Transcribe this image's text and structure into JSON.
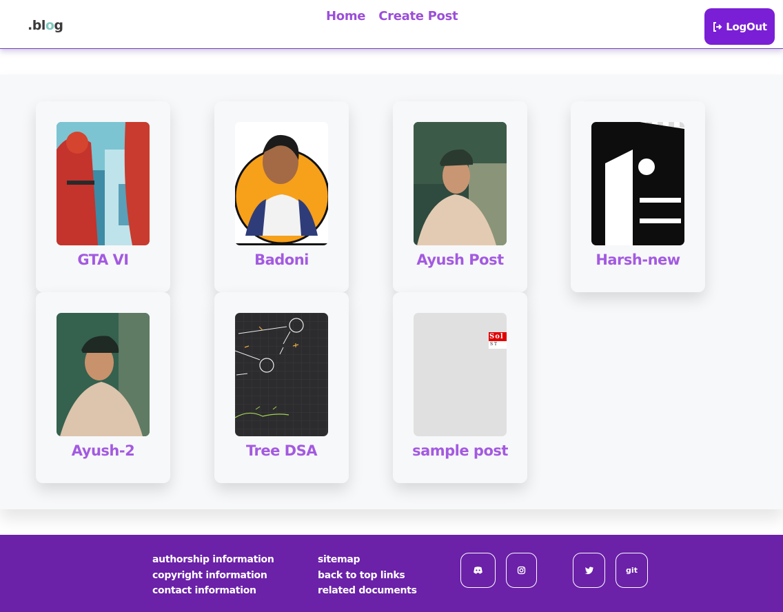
{
  "header": {
    "logo_prefix": ".bl",
    "logo_o": "o",
    "logo_suffix": "g",
    "nav": [
      {
        "label": "Home"
      },
      {
        "label": "Create Post"
      }
    ],
    "logout_label": "LogOut"
  },
  "posts": [
    {
      "title": "GTA VI",
      "image": "gta-vi-art"
    },
    {
      "title": "Badoni",
      "image": "portrait-orange-circle"
    },
    {
      "title": "Ayush Post",
      "image": "selfie-photo"
    },
    {
      "title": "Harsh-new",
      "image": "company-logo-bw"
    },
    {
      "title": "Ayush-2",
      "image": "selfie-photo-2"
    },
    {
      "title": "Tree DSA",
      "image": "tree-diagram-sketch"
    },
    {
      "title": "sample post",
      "image": "placeholder-gray",
      "image_text": "Sol",
      "image_subtext": "S T"
    }
  ],
  "footer": {
    "col1": [
      "authorship information",
      "copyright information",
      "contact information"
    ],
    "col2": [
      "sitemap",
      "back to top links",
      "related documents"
    ],
    "social": [
      {
        "name": "discord-icon"
      },
      {
        "name": "instagram-icon"
      },
      {
        "name": "twitter-icon"
      },
      {
        "name": "github-icon",
        "label": "git"
      }
    ]
  },
  "colors": {
    "accent": "#7a1fd6",
    "nav_text": "#9b4fd8",
    "card_title": "#a35ae0",
    "footer_bg": "#6b21a8"
  }
}
